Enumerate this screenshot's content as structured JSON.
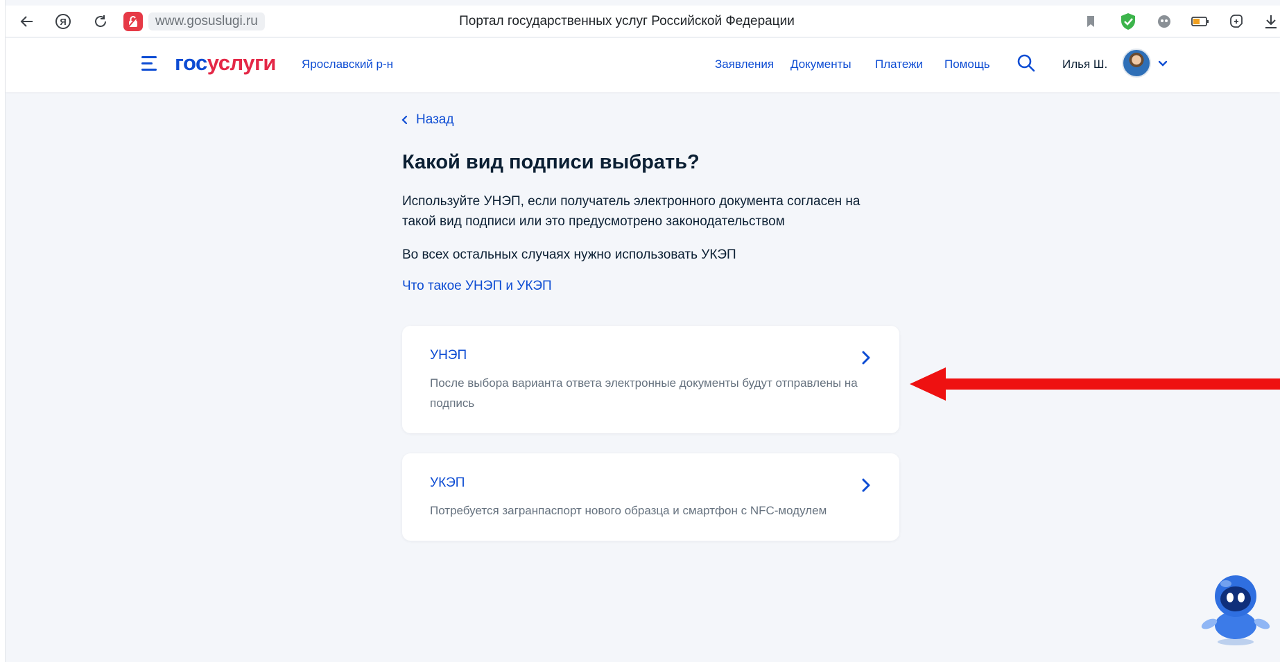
{
  "browser": {
    "url": "www.gosuslugi.ru",
    "tab_title": "Портал государственных услуг Российской Федерации",
    "ya_letter": "Я"
  },
  "header": {
    "logo_gos": "гос",
    "logo_uslugi": "услуги",
    "region": "Ярославский р-н",
    "nav": [
      "Заявления",
      "Документы",
      "Платежи",
      "Помощь"
    ],
    "user_name": "Илья Ш."
  },
  "content": {
    "back": "Назад",
    "title": "Какой вид подписи выбрать?",
    "paragraph1": "Используйте УНЭП, если получатель электронного документа согласен на такой вид подписи или это предусмотрено законодательством",
    "paragraph2": "Во всех остальных случаях нужно использовать УКЭП",
    "info_link": "Что такое УНЭП и УКЭП",
    "options": [
      {
        "title": "УНЭП",
        "description": "После выбора варианта ответа электронные документы будут отправлены на подпись"
      },
      {
        "title": "УКЭП",
        "description": "Потребуется загранпаспорт нового образца и смартфон с NFC-модулем"
      }
    ]
  },
  "colors": {
    "brand_blue": "#0d4cd3",
    "brand_red": "#e42847",
    "arrow_red": "#ee1111"
  }
}
